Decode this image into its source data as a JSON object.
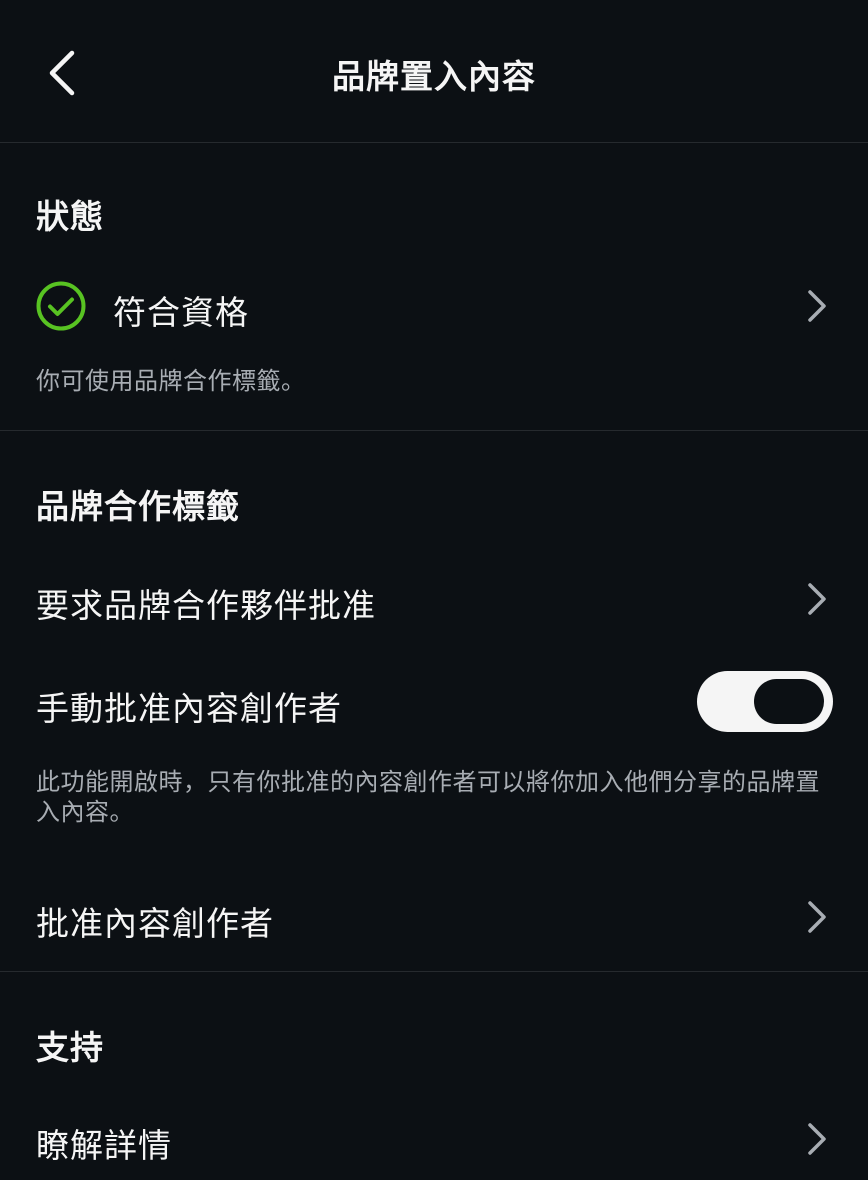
{
  "header": {
    "title": "品牌置入內容",
    "back_icon": "chevron-left-icon"
  },
  "status_section": {
    "title": "狀態",
    "status_label": "符合資格",
    "status_icon": "check-circle-icon",
    "status_color": "#58c322",
    "description": "你可使用品牌合作標籤。"
  },
  "brand_tag_section": {
    "title": "品牌合作標籤",
    "request_approval_label": "要求品牌合作夥伴批准",
    "manual_approve_label": "手動批准內容創作者",
    "manual_approve_enabled": true,
    "manual_approve_note": "此功能開啟時，只有你批准的內容創作者可以將你加入他們分享的品牌置入內容。",
    "approved_creators_label": "批准內容創作者"
  },
  "support_section": {
    "title": "支持",
    "learn_more_label": "瞭解詳情"
  },
  "colors": {
    "background": "#0c1014",
    "text": "#f5f5f5",
    "secondary_text": "#a8adb3",
    "divider": "#262a2e",
    "chevron": "#a8adb3"
  }
}
